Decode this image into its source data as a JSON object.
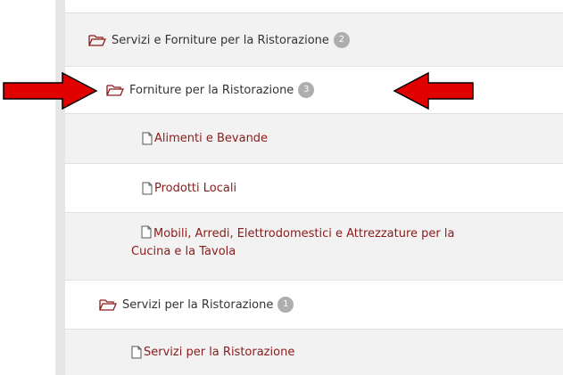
{
  "tree": {
    "root": {
      "label": "Servizi e Forniture per la Ristorazione",
      "count": "2"
    },
    "forniture": {
      "label": "Forniture per la Ristorazione",
      "count": "3"
    },
    "files": [
      {
        "label": "Alimenti e Bevande"
      },
      {
        "label": "Prodotti Locali"
      },
      {
        "label": "Mobili, Arredi, Elettrodomestici e Attrezzature per la",
        "label2": "Cucina e la Tavola"
      }
    ],
    "servizi": {
      "label": "Servizi per la Ristorazione",
      "count": "1"
    },
    "servizi_files": [
      {
        "label": "Servizi per la Ristorazione"
      }
    ]
  },
  "colors": {
    "link": "#8b1a1a",
    "badge": "#aeaeae",
    "arrow": "#e00000",
    "folder": "#8b1a1a"
  },
  "icons": {
    "folder": "folder-open-icon",
    "file": "document-icon",
    "arrow": "red-arrow"
  }
}
